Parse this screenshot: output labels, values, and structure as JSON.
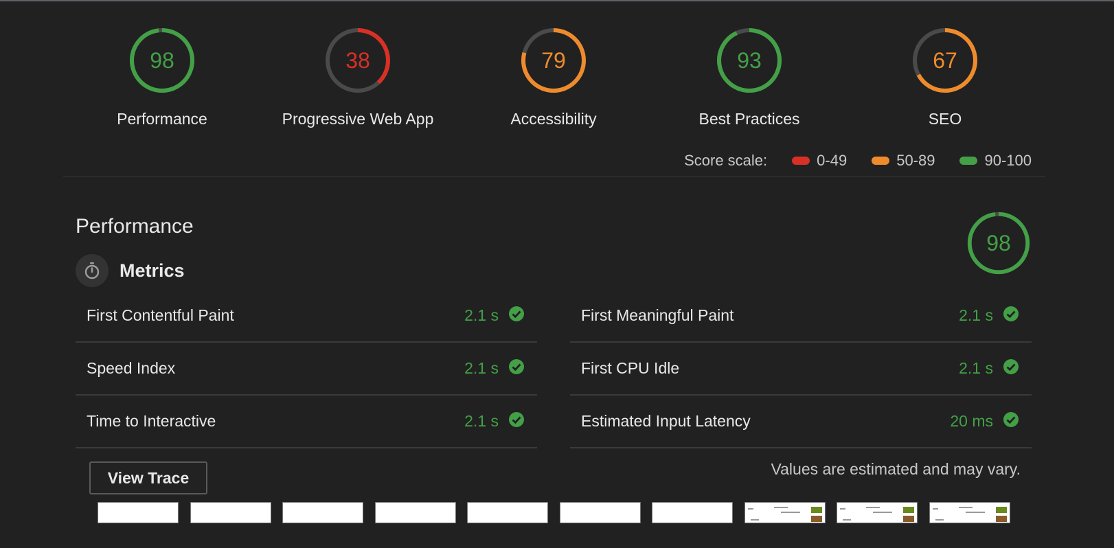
{
  "categories": [
    {
      "label": "Performance",
      "score": 98,
      "color": "#43a047"
    },
    {
      "label": "Progressive Web App",
      "score": 38,
      "color": "#d93025"
    },
    {
      "label": "Accessibility",
      "score": 79,
      "color": "#ef8b2c"
    },
    {
      "label": "Best Practices",
      "score": 93,
      "color": "#43a047"
    },
    {
      "label": "SEO",
      "score": 67,
      "color": "#ef8b2c"
    }
  ],
  "score_scale": {
    "label": "Score scale:",
    "ranges": [
      {
        "label": "0-49",
        "color": "#d93025"
      },
      {
        "label": "50-89",
        "color": "#ef8b2c"
      },
      {
        "label": "90-100",
        "color": "#43a047"
      }
    ]
  },
  "performance": {
    "title": "Performance",
    "score": 98,
    "metrics_title": "Metrics",
    "metrics_icon": "stopwatch-icon",
    "metrics_left": [
      {
        "label": "First Contentful Paint",
        "value": "2.1 s"
      },
      {
        "label": "Speed Index",
        "value": "2.1 s"
      },
      {
        "label": "Time to Interactive",
        "value": "2.1 s"
      }
    ],
    "metrics_right": [
      {
        "label": "First Meaningful Paint",
        "value": "2.1 s"
      },
      {
        "label": "First CPU Idle",
        "value": "2.1 s"
      },
      {
        "label": "Estimated Input Latency",
        "value": "20 ms"
      }
    ],
    "view_trace_label": "View Trace",
    "disclaimer": "Values are estimated and may vary.",
    "filmstrip_frames": [
      {
        "content": false
      },
      {
        "content": false
      },
      {
        "content": false
      },
      {
        "content": false
      },
      {
        "content": false
      },
      {
        "content": false
      },
      {
        "content": false
      },
      {
        "content": true
      },
      {
        "content": true
      },
      {
        "content": true
      }
    ]
  },
  "colors": {
    "pass": "#43a047",
    "track": "#4a4a4a",
    "background": "#212121"
  }
}
